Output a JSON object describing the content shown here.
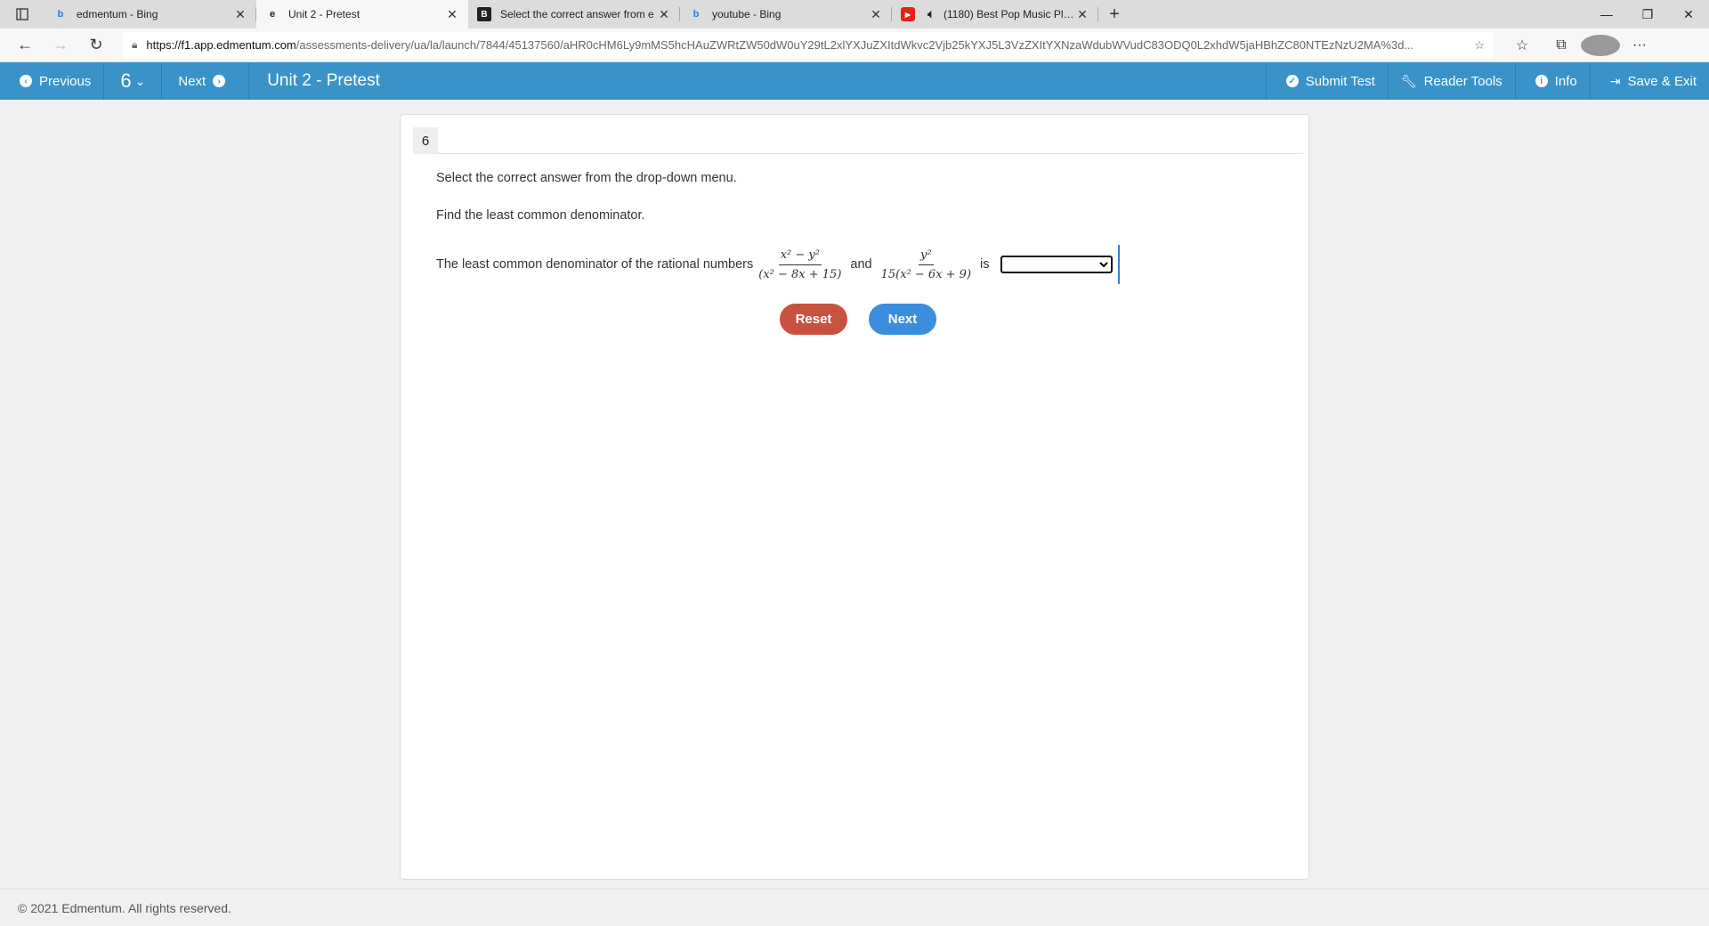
{
  "browser": {
    "tabs": [
      {
        "title": "edmentum - Bing",
        "icon": "bing-icon",
        "active": false
      },
      {
        "title": "Unit 2 - Pretest",
        "icon": "edmentum-icon",
        "active": true
      },
      {
        "title": "Select the correct answer from e",
        "icon": "brainly-icon",
        "active": false
      },
      {
        "title": "youtube - Bing",
        "icon": "bing-icon",
        "active": false
      },
      {
        "title": "(1180) Best Pop Music Playl",
        "icon": "youtube-icon",
        "active": false
      }
    ],
    "url_host": "https://f1.app.edmentum.com",
    "url_path": "/assessments-delivery/ua/la/launch/7844/45137560/aHR0cHM6Ly9mMS5hcHAuZWRtZW50dW0uY29tL2xlYXJuZXItdWkvc2Vjb25kYXJ5L3VzZXItYXNzaWdubWVudC83ODQ0L2xhdW5jaHBhZC80NTEzNzU2MA%3d..."
  },
  "toolbar": {
    "previous": "Previous",
    "question_number": "6",
    "next": "Next",
    "title": "Unit 2 - Pretest",
    "submit": "Submit Test",
    "reader_tools": "Reader Tools",
    "info": "Info",
    "save_exit": "Save & Exit"
  },
  "question": {
    "number": "6",
    "instruction": "Select the correct answer from the drop-down menu.",
    "prompt": "Find the least common denominator.",
    "stem_before": "The least common denominator of the rational numbers",
    "frac1_num": "x² − y²",
    "frac1_den": "(x² − 8x + 15)",
    "word_and": "and",
    "frac2_num": "y²",
    "frac2_den": "15(x² − 6x + 9)",
    "word_is": "is",
    "dropdown_selected": ""
  },
  "buttons": {
    "reset": "Reset",
    "next": "Next"
  },
  "footer": {
    "copyright": "© 2021 Edmentum. All rights reserved."
  },
  "colors": {
    "toolbar_bg": "#3993c9",
    "reset_bg": "#c8523e",
    "next_bg": "#3b8ede"
  }
}
